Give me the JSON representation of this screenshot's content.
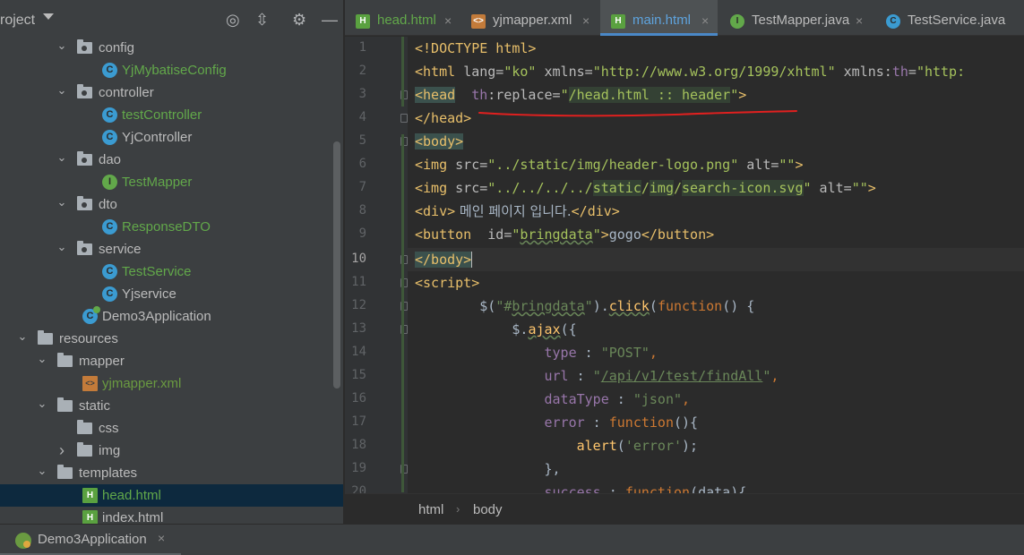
{
  "project_panel": {
    "title": "roject",
    "tree": [
      {
        "label": "config",
        "kind": "folder",
        "depth": 3,
        "expanded": true,
        "color": "normal"
      },
      {
        "label": "YjMybatiseConfig",
        "kind": "class",
        "depth": 4,
        "color": "green"
      },
      {
        "label": "controller",
        "kind": "folder",
        "depth": 3,
        "expanded": true,
        "color": "normal"
      },
      {
        "label": "testController",
        "kind": "class",
        "depth": 4,
        "color": "green"
      },
      {
        "label": "YjController",
        "kind": "class",
        "depth": 4,
        "color": "normal"
      },
      {
        "label": "dao",
        "kind": "folder",
        "depth": 3,
        "expanded": true,
        "color": "normal"
      },
      {
        "label": "TestMapper",
        "kind": "interface",
        "depth": 4,
        "color": "green"
      },
      {
        "label": "dto",
        "kind": "folder",
        "depth": 3,
        "expanded": true,
        "color": "normal"
      },
      {
        "label": "ResponseDTO",
        "kind": "class",
        "depth": 4,
        "color": "green"
      },
      {
        "label": "service",
        "kind": "folder",
        "depth": 3,
        "expanded": true,
        "color": "normal"
      },
      {
        "label": "TestService",
        "kind": "class",
        "depth": 4,
        "color": "green"
      },
      {
        "label": "Yjservice",
        "kind": "class",
        "depth": 4,
        "color": "normal"
      },
      {
        "label": "Demo3Application",
        "kind": "app",
        "depth": 3,
        "color": "normal"
      },
      {
        "label": "resources",
        "kind": "folder",
        "depth": 1,
        "expanded": true,
        "color": "normal"
      },
      {
        "label": "mapper",
        "kind": "folder",
        "depth": 2,
        "expanded": true,
        "color": "normal"
      },
      {
        "label": "yjmapper.xml",
        "kind": "xml",
        "depth": 3,
        "color": "dgreen"
      },
      {
        "label": "static",
        "kind": "folder",
        "depth": 2,
        "expanded": true,
        "color": "normal"
      },
      {
        "label": "css",
        "kind": "folder",
        "depth": 3,
        "color": "normal"
      },
      {
        "label": "img",
        "kind": "folder",
        "depth": 3,
        "expanded": false,
        "color": "normal"
      },
      {
        "label": "templates",
        "kind": "folder",
        "depth": 2,
        "expanded": true,
        "color": "normal"
      },
      {
        "label": "head.html",
        "kind": "html",
        "depth": 3,
        "color": "green",
        "selected": true
      },
      {
        "label": "index.html",
        "kind": "html",
        "depth": 3,
        "color": "normal"
      }
    ]
  },
  "tabs": [
    {
      "label": "head.html",
      "icon": "html",
      "style": "html"
    },
    {
      "label": "yjmapper.xml",
      "icon": "xml",
      "style": "normal"
    },
    {
      "label": "main.html",
      "icon": "html",
      "style": "active",
      "active": true
    },
    {
      "label": "TestMapper.java",
      "icon": "interface",
      "style": "normal"
    },
    {
      "label": "TestService.java",
      "icon": "class",
      "style": "normal"
    }
  ],
  "editor": {
    "current_line": 10,
    "line_numbers": [
      "1",
      "2",
      "3",
      "4",
      "5",
      "6",
      "7",
      "8",
      "9",
      "10",
      "11",
      "12",
      "13",
      "14",
      "15",
      "16",
      "17",
      "18",
      "19",
      "20"
    ],
    "line_1": "<!DOCTYPE html>",
    "line_2": {
      "tag_open": "<html ",
      "a1": "lang=",
      "v1": "\"ko\"",
      "a2": " xmlns=",
      "v2": "\"http://www.w3.org/1999/xhtml\"",
      "a3": " xmlns:",
      "a3b": "th",
      "a3c": "=",
      "v3": "\"http:"
    },
    "line_3": {
      "tag_open": "<head",
      "ns": "th",
      "attr": ":replace=",
      "q1": "\"",
      "val": "/head.html :: header",
      "q2": "\"",
      "tag_close": ">"
    },
    "line_4": "</head>",
    "line_5": "<body>",
    "line_6": {
      "tag": "<img ",
      "a1": "src=",
      "v1": "\"../static/img/header-logo.png\"",
      "a2": " alt=",
      "v2": "\"\"",
      "end": ">"
    },
    "line_7": {
      "tag": "<img ",
      "a1": "src=",
      "v1a": "\"../../../../",
      "v1b": "static",
      "v1c": "/",
      "v1d": "img",
      "v1e": "/",
      "v1f": "search-icon.svg",
      "v1g": "\"",
      "a2": " alt=",
      "v2": "\"\"",
      "end": ">"
    },
    "line_8": {
      "open": "<div>",
      "text": " 메인 페이지 입니다.",
      "close": "</div>"
    },
    "line_9": {
      "open": "<button ",
      "a1": " id=",
      "v1a": "\"",
      "v1b": "bringdata",
      "v1c": "\"",
      "end": ">",
      "text": "gogo",
      "close": "</button>"
    },
    "line_10": "</body>",
    "line_11": "<script>",
    "line_12": {
      "indent": "        ",
      "p1": "$(",
      "s1": "\"#",
      "s2": "bringdata",
      "s3": "\"",
      "p2": ").",
      "fn": "click",
      "p3": "(",
      "kw": "function",
      "p4": "() {"
    },
    "line_13": {
      "indent": "            ",
      "p1": "$.",
      "fn": "ajax",
      "p2": "({"
    },
    "line_14": {
      "indent": "                ",
      "prop": "type",
      "p1": " : ",
      "str": "\"POST\"",
      "p2": ","
    },
    "line_15": {
      "indent": "                ",
      "prop": "url",
      "p1": " : ",
      "s1": "\"",
      "s2": "/api/v1/test/findAll",
      "s3": "\"",
      "p2": ","
    },
    "line_16": {
      "indent": "                ",
      "prop": "dataType",
      "p1": " : ",
      "str": "\"json\"",
      "p2": ","
    },
    "line_17": {
      "indent": "                ",
      "prop": "error",
      "p1": " : ",
      "kw": "function",
      "p2": "(){"
    },
    "line_18": {
      "indent": "                    ",
      "fn": "alert",
      "p1": "(",
      "str": "'error'",
      "p2": ");"
    },
    "line_19": {
      "indent": "                ",
      "p1": "},"
    },
    "line_20": {
      "indent": "                ",
      "prop": "success",
      "p1": " : ",
      "kw": "function",
      "p2": "(data){"
    }
  },
  "breadcrumb": {
    "item1": "html",
    "separator": "›",
    "item2": "body"
  },
  "runbar": {
    "label": "Demo3Application",
    "close": "×"
  },
  "icons": {
    "locate": "◎",
    "collapse": "⇳",
    "settings": "⚙",
    "hide": "—",
    "close": "×",
    "chevron_down": "⌄",
    "chevron_right": "›"
  },
  "colors": {
    "accent": "#4a88c7",
    "annotation": "#e0201f",
    "green_file": "#62a84a"
  }
}
